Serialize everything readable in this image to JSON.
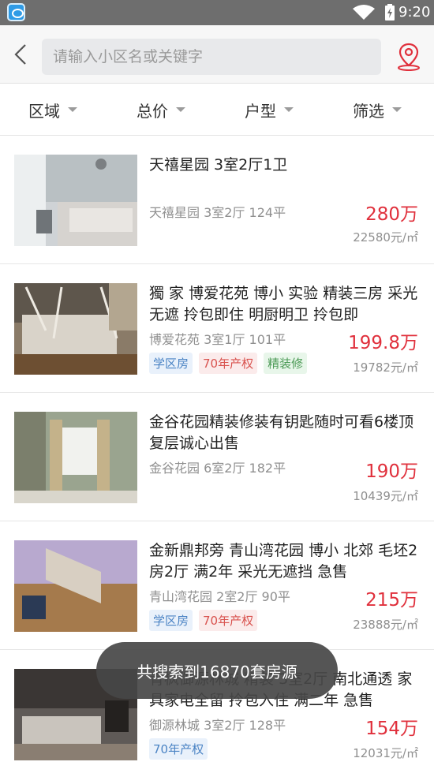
{
  "status_bar": {
    "time": "9:20"
  },
  "search": {
    "placeholder": "请输入小区名或关键字"
  },
  "filters": [
    "区域",
    "总价",
    "户型",
    "筛选"
  ],
  "listings": [
    {
      "title": "天禧星园 3室2厅1卫",
      "sub": "天禧星园 3室2厅 124平",
      "price": "280万",
      "unit_price": "22580元/㎡",
      "tags": []
    },
    {
      "title": "獨 家 博爱花苑 博小 实验 精装三房 采光无遮 拎包即住 明厨明卫 拎包即",
      "sub": "博爱花苑 3室1厅 101平",
      "price": "199.8万",
      "unit_price": "19782元/㎡",
      "tags": [
        "学区房",
        "70年产权",
        "精装修"
      ]
    },
    {
      "title": "金谷花园精装修装有钥匙随时可看6楼顶复层诚心出售",
      "sub": "金谷花园 6室2厅 182平",
      "price": "190万",
      "unit_price": "10439元/㎡",
      "tags": []
    },
    {
      "title": "金新鼎邦旁 青山湾花园 博小 北郊 毛坯2房2厅 满2年 采光无遮挡 急售",
      "sub": "青山湾花园 2室2厅 90平",
      "price": "215万",
      "unit_price": "23888元/㎡",
      "tags": [
        "学区房",
        "70年产权"
      ]
    },
    {
      "title": "青枫御源林城 精装 3室2厅 南北通透 家具家电全留 拎包入住 满二年 急售",
      "sub": "御源林城 3室2厅 128平",
      "price": "154万",
      "unit_price": "12031元/㎡",
      "tags": [
        "70年产权"
      ]
    }
  ],
  "toast": "共搜索到16870套房源",
  "colors": {
    "price": "#e0303c",
    "status_bar": "#6e6e6e",
    "tag_blue": "#4a83c4",
    "tag_red": "#d9534f",
    "tag_green": "#4c9a56"
  }
}
